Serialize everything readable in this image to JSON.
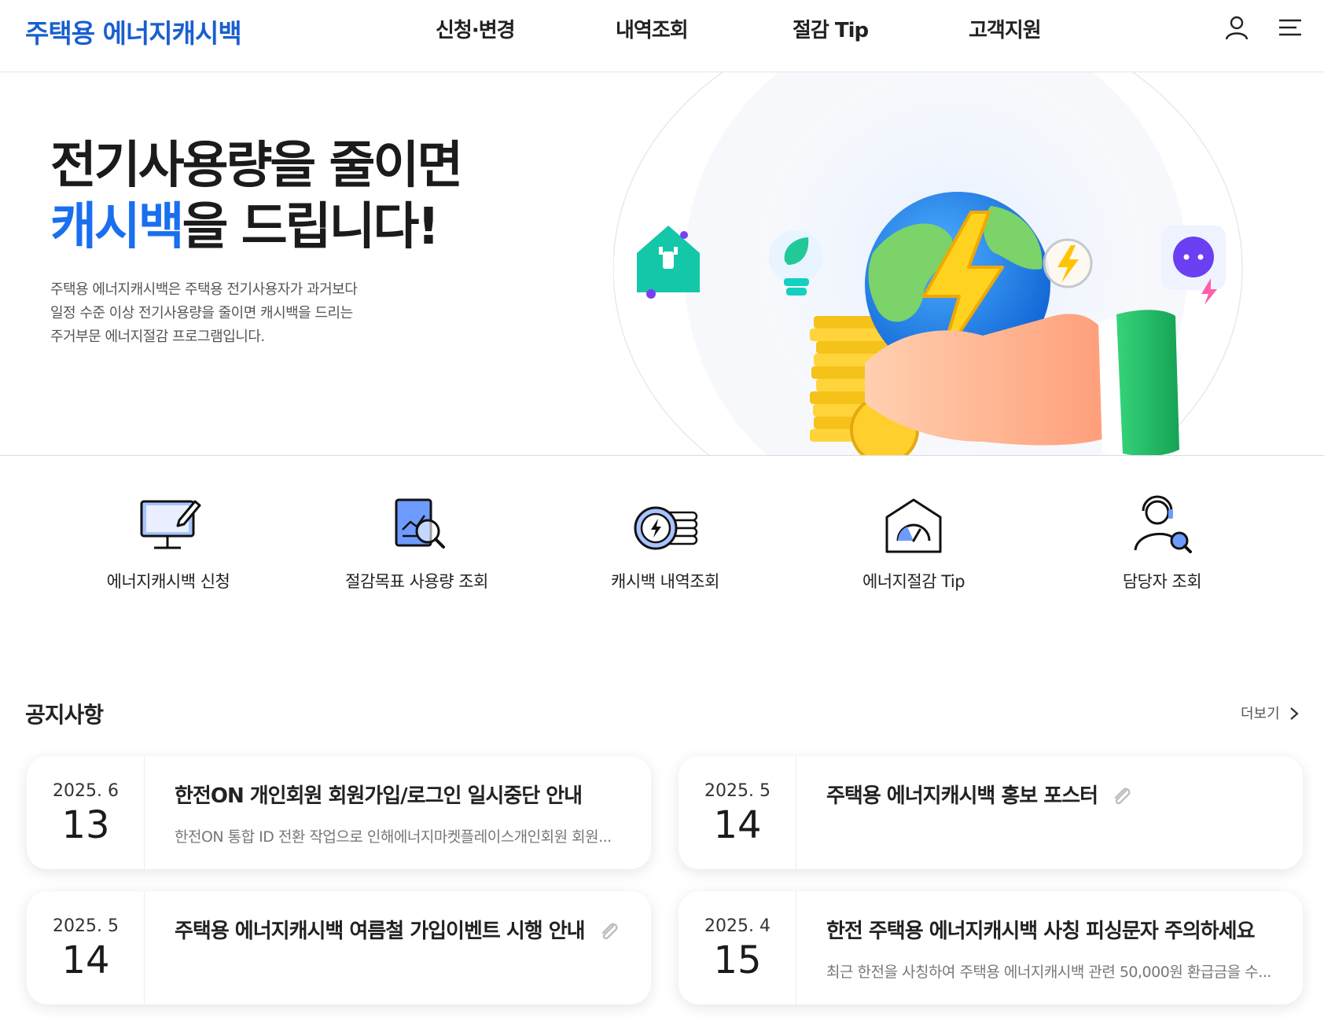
{
  "header": {
    "logo": "주택용 에너지캐시백",
    "nav": [
      "신청·변경",
      "내역조회",
      "절감 Tip",
      "고객지원"
    ],
    "user_icon": "user-icon",
    "menu_icon": "hamburger-menu-icon"
  },
  "hero": {
    "title_line1": "전기사용량을 줄이면",
    "title_accent": "캐시백",
    "title_rest": "을 드립니다!",
    "desc_line1": "주택용 에너지캐시백은 주택용 전기사용자가 과거보다",
    "desc_line2": "일정 수준 이상 전기사용량을 줄이면 캐시백을 드리는",
    "desc_line3": "주거부문 에너지절감 프로그램입니다."
  },
  "quick_menu": [
    {
      "label": "에너지캐시백 신청",
      "icon": "monitor-pen-icon"
    },
    {
      "label": "절감목표 사용량 조회",
      "icon": "report-search-icon"
    },
    {
      "label": "캐시백 내역조회",
      "icon": "coin-lightning-icon"
    },
    {
      "label": "에너지절감 Tip",
      "icon": "gauge-house-icon"
    },
    {
      "label": "담당자 조회",
      "icon": "person-search-icon"
    }
  ],
  "notice": {
    "title": "공지사항",
    "more": "더보기",
    "items": [
      {
        "ym": "2025. 6",
        "day": "13",
        "title": "한전ON 개인회원 회원가입/로그인 일시중단 안내",
        "summary": "한전ON 통합 ID 전환 작업으로 인해에너지마켓플레이스개인회원 회원...",
        "attachment": false
      },
      {
        "ym": "2025. 5",
        "day": "14",
        "title": "주택용 에너지캐시백 홍보 포스터",
        "summary": "",
        "attachment": true
      },
      {
        "ym": "2025. 5",
        "day": "14",
        "title": "주택용 에너지캐시백 여름철 가입이벤트 시행 안내",
        "summary": "",
        "attachment": true
      },
      {
        "ym": "2025. 4",
        "day": "15",
        "title": "한전 주택용 에너지캐시백 사칭 피싱문자 주의하세요",
        "summary": "최근 한전을 사칭하여 주택용 에너지캐시백 관련 50,000원 환급금을 수...",
        "attachment": false
      }
    ]
  },
  "colors": {
    "brand": "#1a5fd0",
    "accent": "#1a6ff0"
  }
}
